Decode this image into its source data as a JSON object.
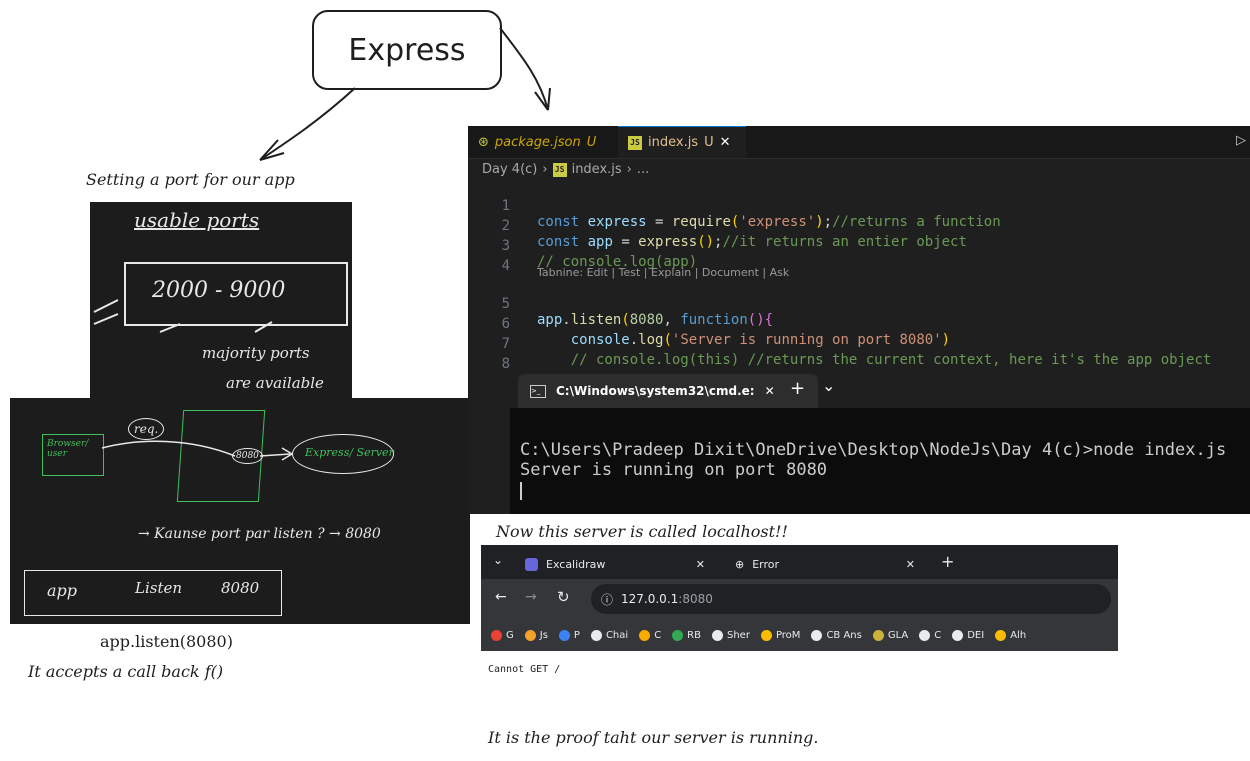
{
  "express_label": "Express",
  "port_caption": "Setting a port for our app",
  "listen_caption": "app.listen(8080)",
  "callback_caption": "It accepts a call back f()",
  "localhost_caption": "Now this server is called localhost!!",
  "proof_caption": "It is the proof taht our server is running.",
  "board_top": {
    "heading": "usable ports",
    "range": "2000 - 9000",
    "note_line1": "majority ports",
    "note_line2": "are available"
  },
  "board_bottom": {
    "req_label": "req.",
    "browser_label": "Browser/ user",
    "port_label": "8080",
    "server_label": "Express/ Server",
    "question": "→ Kaunse port par listen ? → 8080",
    "code_app": "app",
    "code_listen": "Listen",
    "code_port": "8080"
  },
  "vscode": {
    "tab_package": "package.json",
    "tab_package_status": "U",
    "tab_index": "index.js",
    "tab_index_status": "U",
    "close_glyph": "✕",
    "breadcrumb_folder": "Day 4(c)",
    "breadcrumb_file": "index.js",
    "breadcrumb_more": "...",
    "codelens": "Tabnine: Edit | Test | Explain | Document | Ask",
    "line_numbers": [
      "1",
      "2",
      "3",
      "4",
      "5",
      "6",
      "7",
      "8"
    ],
    "code": {
      "l1_kw": "const",
      "l1_var": " express ",
      "l1_eq": "= ",
      "l1_fn": "require",
      "l1_str": "'express'",
      "l1_cm": "//returns a function",
      "l2_kw": "const",
      "l2_var": " app ",
      "l2_eq": "= ",
      "l2_fn": "express",
      "l2_cm": "//it returns an entier object",
      "l3_cm": "// console.log(app)",
      "l5_var": "app",
      "l5_fn": "listen",
      "l5_num": "8080",
      "l5_kw": "function",
      "l6_var": "console",
      "l6_fn": "log",
      "l6_str": "'Server is running on port 8080'",
      "l7_cm": "// console.log(this) //returns the current context, here it's the app object"
    }
  },
  "terminal": {
    "tab_title": "C:\\Windows\\system32\\cmd.e:",
    "close_glyph": "✕",
    "add_glyph": "+",
    "dropdown_glyph": "⌄",
    "prompt_line": "C:\\Users\\Pradeep Dixit\\OneDrive\\Desktop\\NodeJs\\Day 4(c)>node index.js",
    "output_line": "Server is running on port 8080"
  },
  "chrome": {
    "tab1_title": "Excalidraw",
    "tab2_title": "Error",
    "close_glyph": "✕",
    "new_tab_glyph": "+",
    "tab_menu_glyph": "⌄",
    "url_host": "127.0.0.1",
    "url_port": ":8080",
    "bookmarks": [
      {
        "label": "G",
        "color": "#ea4335"
      },
      {
        "label": "Js",
        "color": "#f4a12c"
      },
      {
        "label": "P",
        "color": "#3b82f6"
      },
      {
        "label": "Chai",
        "color": "#e8eaed"
      },
      {
        "label": "C",
        "color": "#f9ab00"
      },
      {
        "label": "RB",
        "color": "#34a853"
      },
      {
        "label": "Sher",
        "color": "#e8eaed"
      },
      {
        "label": "ProM",
        "color": "#fbbc04"
      },
      {
        "label": "CB Ans",
        "color": "#e8eaed"
      },
      {
        "label": "GLA",
        "color": "#c9b33a"
      },
      {
        "label": "C",
        "color": "#e8eaed"
      },
      {
        "label": "DEI",
        "color": "#e8eaed"
      },
      {
        "label": "Alh",
        "color": "#fbbc04"
      }
    ]
  },
  "page_body": "Cannot GET /"
}
